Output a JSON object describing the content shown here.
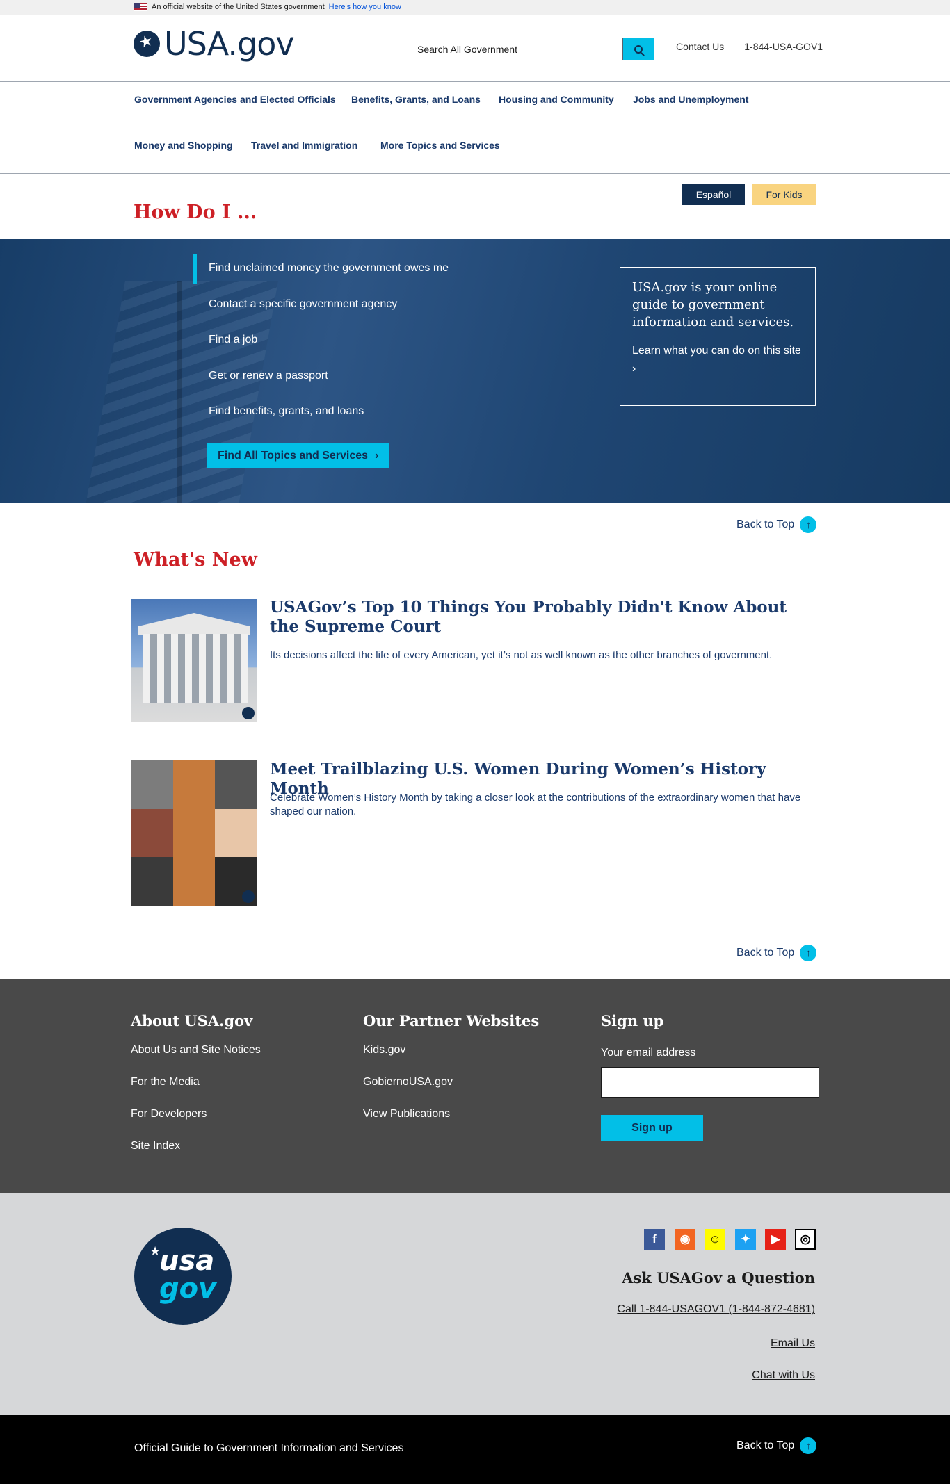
{
  "banner": {
    "text": "An official website of the United States government",
    "link": "Here's how you know"
  },
  "header": {
    "logo_usa": "USA",
    "logo_gov": ".gov",
    "search_placeholder": "Search All Government",
    "contact": "Contact Us",
    "phone": "1-844-USA-GOV1"
  },
  "nav": {
    "items": [
      "Government Agencies and Elected Officials",
      "Benefits, Grants, and Loans",
      "Housing and Community",
      "Jobs and Unemployment",
      "Money and Shopping",
      "Travel and Immigration",
      "More Topics and Services"
    ]
  },
  "lang": {
    "espanol": "Español",
    "kids": "For Kids"
  },
  "howdoi": {
    "title": "How Do I ...",
    "items": [
      "Find unclaimed money the government owes me",
      "Contact a specific government agency",
      "Find a job",
      "Get or renew a passport",
      "Find benefits, grants, and loans"
    ],
    "button": "Find All Topics and Services",
    "box_title": "USA.gov is your online guide to government information and services.",
    "box_link": "Learn what you can do on this site"
  },
  "back_to_top": "Back to Top",
  "whatsnew": {
    "title": "What's New",
    "articles": [
      {
        "title": "USAGov’s Top 10 Things You Probably Didn't Know About the Supreme Court",
        "desc": "Its decisions affect the life of every American, yet it’s not as well known as the other branches of government."
      },
      {
        "title": "Meet Trailblazing U.S. Women During Women’s History Month",
        "desc": "Celebrate Women’s History Month by taking a closer look at the contributions of the extraordinary women that have shaped our nation."
      }
    ]
  },
  "footer": {
    "about_title": "About USA.gov",
    "about_links": [
      "About Us and Site Notices",
      "For the Media",
      "For Developers",
      "Site Index"
    ],
    "partner_title": "Our Partner Websites",
    "partner_links": [
      "Kids.gov",
      "GobiernoUSA.gov",
      "View Publications"
    ],
    "signup_title": "Sign up",
    "email_label": "Your email address",
    "signup_button": "Sign up",
    "logo_top": "usa",
    "logo_bottom": "gov",
    "ask_title": "Ask USAGov a Question",
    "call": "Call 1-844-USAGOV1 (1-844-872-4681)",
    "email_us": "Email Us",
    "chat": "Chat with Us",
    "tagline": "Official Guide to Government Information and Services"
  },
  "colors": {
    "navy": "#112e51",
    "cyan": "#02bfe7",
    "red": "#cd2026",
    "gold": "#f9d480",
    "footer_dark": "#494949",
    "footer_light": "#d6d7d9"
  }
}
